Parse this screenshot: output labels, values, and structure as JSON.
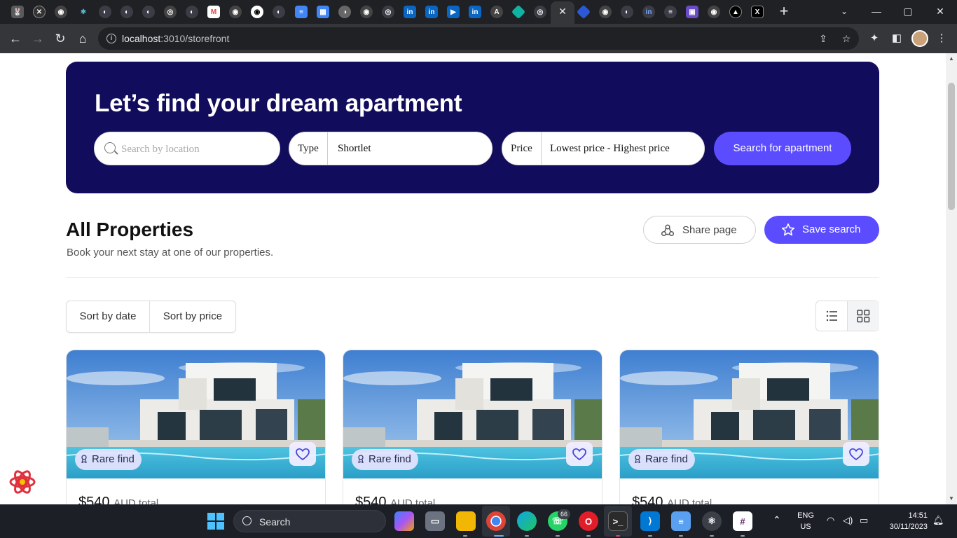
{
  "browser": {
    "url_host": "localhost",
    "url_path": ":3010/storefront",
    "new_tab": "+",
    "minimize": "—",
    "maximize": "▢",
    "close": "✕"
  },
  "hero": {
    "title": "Let’s find your dream apartment",
    "search_placeholder": "Search by location",
    "type_label": "Type",
    "type_value": "Shortlet",
    "price_label": "Price",
    "price_value": "Lowest price - Highest price",
    "search_button": "Search for apartment"
  },
  "section": {
    "title": "All Properties",
    "subtitle": "Book your next stay at one of our properties.",
    "share_button": "Share page",
    "save_button": "Save search"
  },
  "sort": {
    "by_date": "Sort by date",
    "by_price": "Sort by price"
  },
  "cards": [
    {
      "badge": "Rare find",
      "price": "$540",
      "currency": "AUD total"
    },
    {
      "badge": "Rare find",
      "price": "$540",
      "currency": "AUD total"
    },
    {
      "badge": "Rare find",
      "price": "$540",
      "currency": "AUD total"
    }
  ],
  "taskbar": {
    "search_label": "Search",
    "whatsapp_badge": "66",
    "lang_top": "ENG",
    "lang_bottom": "US",
    "time": "14:51",
    "date": "30/11/2023"
  },
  "colors": {
    "hero_bg": "#120c5c",
    "accent": "#5b4cff",
    "chrome_dark": "#202124",
    "taskbar": "#1c1f26"
  }
}
